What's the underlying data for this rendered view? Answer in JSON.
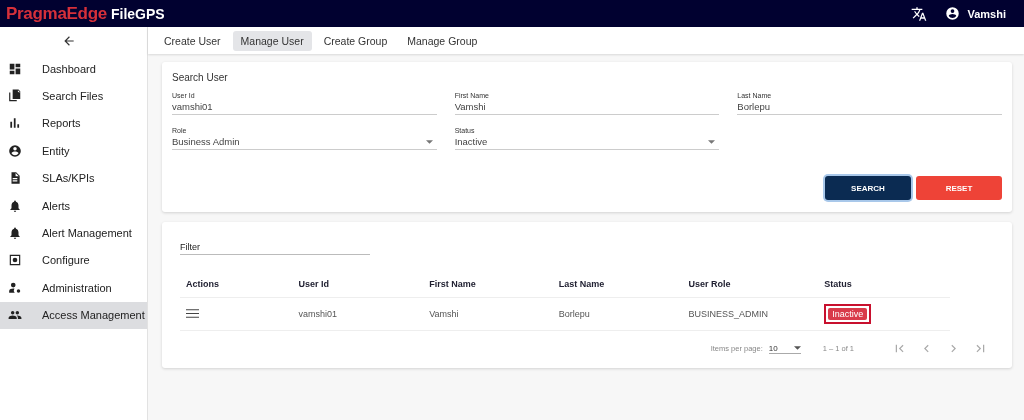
{
  "header": {
    "brand": "PragmaEdge",
    "product": "FileGPS",
    "user": "Vamshi"
  },
  "sidebar": {
    "items": [
      {
        "label": "Dashboard",
        "selected": false
      },
      {
        "label": "Search Files",
        "selected": false
      },
      {
        "label": "Reports",
        "selected": false
      },
      {
        "label": "Entity",
        "selected": false
      },
      {
        "label": "SLAs/KPIs",
        "selected": false
      },
      {
        "label": "Alerts",
        "selected": false
      },
      {
        "label": "Alert Management",
        "selected": false
      },
      {
        "label": "Configure",
        "selected": false
      },
      {
        "label": "Administration",
        "selected": false
      },
      {
        "label": "Access Management",
        "selected": true
      }
    ]
  },
  "tabs": [
    {
      "label": "Create User",
      "selected": false
    },
    {
      "label": "Manage User",
      "selected": true
    },
    {
      "label": "Create Group",
      "selected": false
    },
    {
      "label": "Manage Group",
      "selected": false
    }
  ],
  "search_card": {
    "title": "Search User",
    "fields": [
      {
        "kind": "text",
        "label": "User Id",
        "value": "vamshi01"
      },
      {
        "kind": "text",
        "label": "First Name",
        "value": "Vamshi"
      },
      {
        "kind": "text",
        "label": "Last Name",
        "value": "Borlepu"
      },
      {
        "kind": "select",
        "label": "Role",
        "value": "Business Admin"
      },
      {
        "kind": "select",
        "label": "Status",
        "value": "Inactive"
      }
    ],
    "buttons": [
      {
        "label": "SEARCH",
        "kind": "primary"
      },
      {
        "label": "RESET",
        "kind": "danger"
      }
    ]
  },
  "table": {
    "filter_placeholder": "Filter",
    "columns": [
      "Actions",
      "User Id",
      "First Name",
      "Last Name",
      "User Role",
      "Status"
    ],
    "rows": [
      {
        "user_id": "vamshi01",
        "first_name": "Vamshi",
        "last_name": "Borlepu",
        "role": "BUSINESS_ADMIN",
        "status": "Inactive",
        "highlighted": true
      }
    ],
    "paginator": {
      "items_label": "Items per page:",
      "page_size": "10",
      "range": "1 – 1 of 1"
    }
  }
}
